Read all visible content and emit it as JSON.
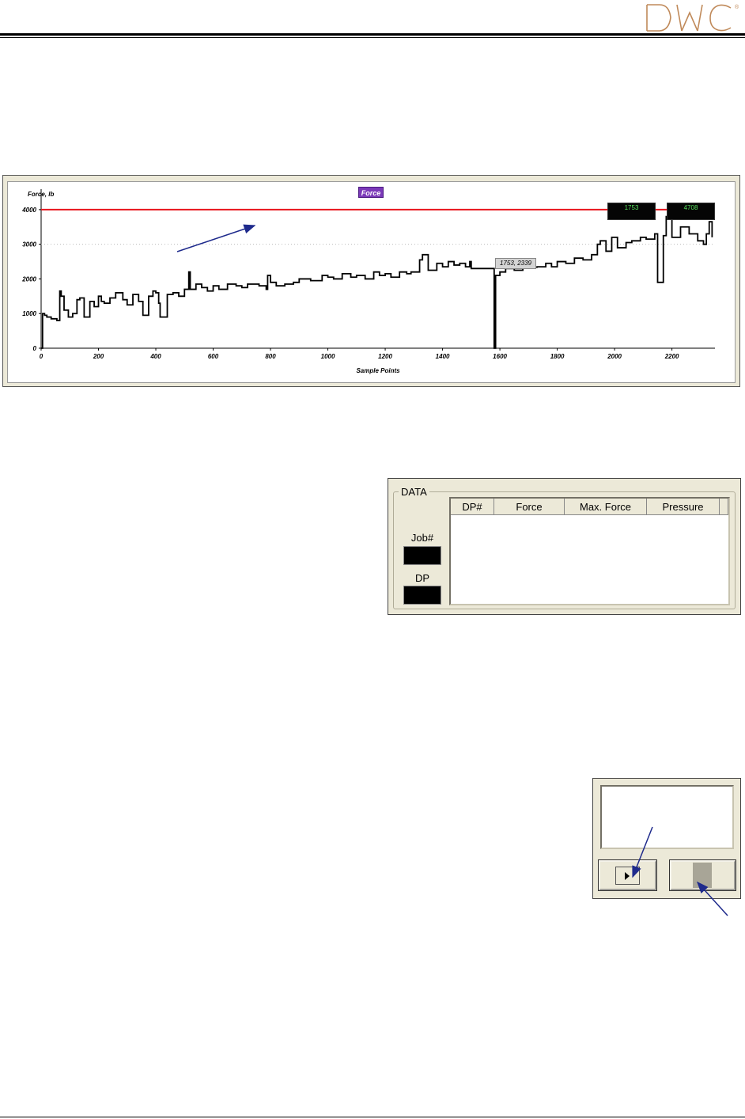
{
  "chart_data": {
    "type": "line",
    "title": "",
    "xlabel": "Sample Points",
    "ylabel": "Force, lb",
    "legend": [
      "Force"
    ],
    "xlim": [
      0,
      2350
    ],
    "ylim": [
      0,
      4500
    ],
    "x_ticks": [
      0,
      200,
      400,
      600,
      800,
      1000,
      1200,
      1400,
      1600,
      1800,
      2000,
      2200
    ],
    "y_ticks": [
      0,
      1000,
      2000,
      3000,
      4000
    ],
    "grid": false,
    "limit_line": {
      "value": 4000,
      "color": "#e8141c"
    },
    "reference_line": {
      "value": 3000,
      "style": "dotted"
    },
    "series": [
      {
        "name": "Force",
        "color": "#000000",
        "x": [
          0,
          5,
          12,
          20,
          35,
          55,
          65,
          70,
          80,
          95,
          110,
          125,
          135,
          150,
          170,
          185,
          200,
          210,
          220,
          240,
          260,
          285,
          300,
          320,
          340,
          355,
          375,
          390,
          400,
          410,
          415,
          440,
          460,
          480,
          500,
          515,
          520,
          540,
          560,
          580,
          600,
          620,
          650,
          680,
          700,
          720,
          760,
          785,
          790,
          800,
          820,
          850,
          880,
          900,
          940,
          980,
          1000,
          1020,
          1050,
          1080,
          1100,
          1130,
          1160,
          1180,
          1200,
          1220,
          1250,
          1275,
          1290,
          1320,
          1330,
          1350,
          1380,
          1400,
          1420,
          1440,
          1460,
          1480,
          1495,
          1500,
          1580,
          1585,
          1600,
          1620,
          1650,
          1680,
          1700,
          1730,
          1760,
          1780,
          1800,
          1830,
          1860,
          1890,
          1920,
          1940,
          1950,
          1970,
          1990,
          2010,
          2040,
          2060,
          2090,
          2110,
          2140,
          2150,
          2170,
          2180,
          2200,
          2230,
          2260,
          2290,
          2310,
          2320,
          2330,
          2340
        ],
        "y": [
          0,
          1000,
          950,
          900,
          850,
          800,
          1650,
          1500,
          1100,
          900,
          1000,
          1400,
          1450,
          900,
          1350,
          1200,
          1500,
          1350,
          1300,
          1450,
          1600,
          1400,
          1250,
          1550,
          1350,
          950,
          1500,
          1650,
          1600,
          1300,
          900,
          1550,
          1600,
          1500,
          1700,
          2200,
          1700,
          1850,
          1750,
          1650,
          1800,
          1700,
          1850,
          1800,
          1750,
          1850,
          1800,
          1700,
          2100,
          1900,
          1800,
          1850,
          1900,
          2000,
          1950,
          2100,
          2050,
          2000,
          2150,
          2050,
          2100,
          2000,
          2200,
          2100,
          2150,
          2050,
          2200,
          2150,
          2200,
          2550,
          2700,
          2250,
          2450,
          2350,
          2500,
          2400,
          2450,
          2350,
          2500,
          2300,
          0,
          2100,
          2200,
          2300,
          2250,
          2400,
          2339,
          2350,
          2450,
          2350,
          2500,
          2450,
          2600,
          2550,
          2700,
          3000,
          3100,
          2800,
          3200,
          2900,
          3050,
          3100,
          3200,
          3150,
          3300,
          1900,
          3250,
          3800,
          3200,
          3500,
          3300,
          3100,
          3000,
          3300,
          3650,
          3200
        ]
      }
    ]
  },
  "chart": {
    "legend_label": "Force",
    "readout_left": "1753",
    "readout_right": "4708",
    "tooltip": "1753, 2339"
  },
  "data_panel": {
    "title": "DATA",
    "job_label": "Job#",
    "dp_label": "DP",
    "columns": [
      "DP#",
      "Force",
      "Max. Force",
      "Pressure"
    ]
  }
}
